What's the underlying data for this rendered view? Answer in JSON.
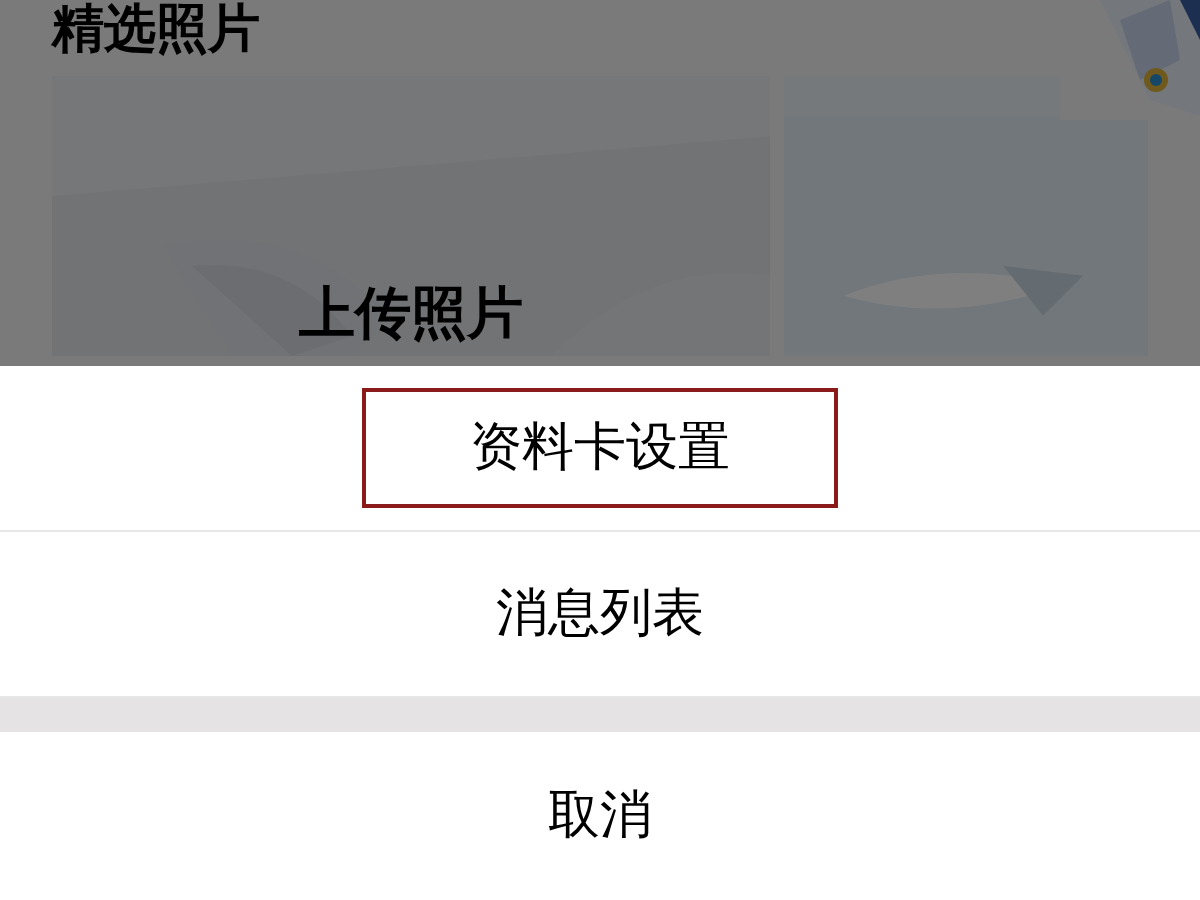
{
  "page_title": "精选照片",
  "upload_label": "上传照片",
  "action_sheet": {
    "items": [
      {
        "label": "资料卡设置",
        "highlighted": true
      },
      {
        "label": "消息列表",
        "highlighted": false
      }
    ],
    "cancel": "取消"
  }
}
